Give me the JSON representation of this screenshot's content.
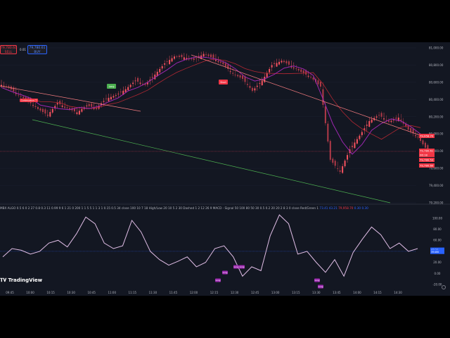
{
  "trade": {
    "sell_price": "79,780.60",
    "sell_label": "SELL",
    "spread": "0.01",
    "buy_price": "79,780.61",
    "buy_label": "BUY"
  },
  "price_axis": {
    "labels": [
      "81,000.00",
      "80,800.00",
      "80,600.00",
      "80,400.00",
      "80,200.00",
      "80,000.00",
      "79,800.00",
      "79,600.00",
      "79,400.00",
      "79,200.00"
    ],
    "tags": [
      {
        "text": "79,958.70",
        "color": "#f23645"
      },
      {
        "text": "79,780.61",
        "color": "#f23645"
      },
      {
        "text": "06:18",
        "color": "#f23645"
      },
      {
        "text": "79,780.53",
        "color": "#f23645"
      },
      {
        "text": "79,780.60",
        "color": "#f23645"
      }
    ]
  },
  "indicator": {
    "legend": "MBX ALGO 0.5 6 0 2 27 0.8 0.3 11 0.99 9 6 1 21 0 200 1 1 5 5 1 1 3 1 0.15 0.5 34 close 100 10 7 18 High/Low 20 10 5 2 30 Dashed 1 2 12 26 9 MACD - Signal 50 100 80 50 30 0.5 0.2 20 20 2 8 3 0 close Red/Green 1",
    "legend_values": [
      "73.41",
      "43.21",
      "79,958.70",
      "0.30",
      "0.30"
    ],
    "axis_labels": [
      "100.00",
      "80.00",
      "60.00",
      "40.00",
      "20.00",
      "0.00",
      "-20.00"
    ],
    "tags": [
      {
        "text": "43.21",
        "color": "#2962ff"
      },
      {
        "text": "39.86",
        "color": "#2962ff"
      }
    ]
  },
  "signals": [
    {
      "label": "Long",
      "color": "#4caf50"
    },
    {
      "label": "Short",
      "color": "#f23645"
    },
    {
      "label": "Continuation ↑",
      "color": "#f23645"
    }
  ],
  "osc_markers": [
    "Long",
    "Long",
    "Long",
    "Long",
    "Long",
    "Long"
  ],
  "time_axis": [
    "09:45",
    "10:00",
    "10:15",
    "10:30",
    "10:45",
    "11:00",
    "11:15",
    "11:30",
    "11:45",
    "12:00",
    "12:15",
    "12:30",
    "12:45",
    "13:00",
    "13:15",
    "13:30",
    "13:45",
    "14:00",
    "14:15",
    "14:30"
  ],
  "brand": {
    "logo": "TradingView"
  },
  "colors": {
    "background": "#131722",
    "bull_candle": "#f7525f",
    "ma_purple": "#9c27b0",
    "ma_red": "#b22833",
    "resistance_line": "#f77c80",
    "support_line": "#4caf50",
    "oscillator": "#e1bee7"
  },
  "chart_data": {
    "type": "candlestick",
    "price_range": [
      79200,
      81000
    ],
    "price_series_close": [
      80540,
      80450,
      80380,
      80290,
      80220,
      80360,
      80300,
      80250,
      80330,
      80300,
      80410,
      80450,
      80520,
      80620,
      80570,
      80690,
      80820,
      80900,
      80890,
      80860,
      80930,
      80880,
      80810,
      80700,
      80640,
      80500,
      80620,
      80800,
      80850,
      80790,
      80720,
      80660,
      80550,
      79700,
      79560,
      79820,
      79980,
      80150,
      80220,
      80140,
      80190,
      80050,
      79960,
      79800
    ],
    "oscillator_range": [
      -20,
      110
    ],
    "oscillator_series": [
      30,
      45,
      42,
      35,
      40,
      55,
      60,
      48,
      72,
      102,
      90,
      55,
      45,
      50,
      96,
      75,
      40,
      25,
      15,
      22,
      30,
      12,
      20,
      45,
      50,
      30,
      -5,
      12,
      5,
      68,
      106,
      90,
      35,
      40,
      20,
      2,
      25,
      -5,
      38,
      62,
      84,
      70,
      45,
      55,
      40,
      45
    ]
  }
}
